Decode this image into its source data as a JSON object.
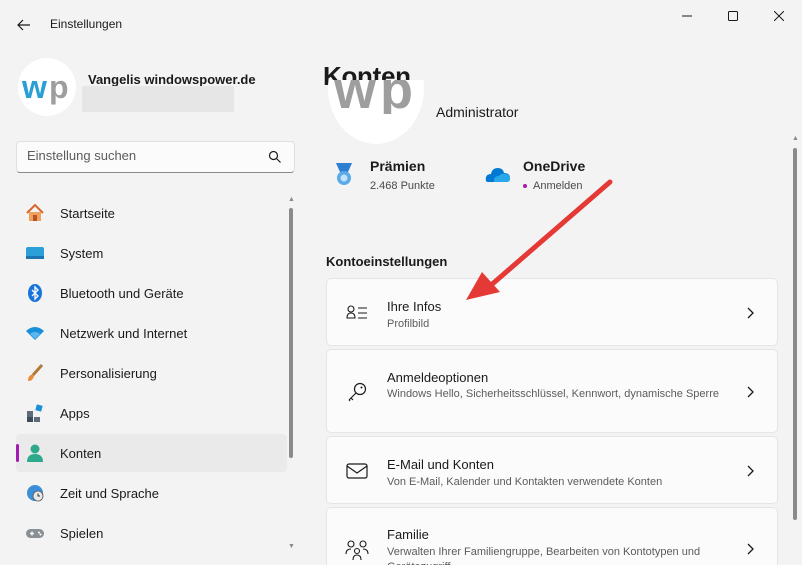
{
  "window": {
    "title": "Einstellungen"
  },
  "profile": {
    "avatar_text": "wp",
    "name": "Vangelis windowspower.de"
  },
  "search": {
    "placeholder": "Einstellung suchen"
  },
  "sidebar": {
    "items": [
      {
        "label": "Startseite",
        "icon": "home-icon"
      },
      {
        "label": "System",
        "icon": "system-icon"
      },
      {
        "label": "Bluetooth und Geräte",
        "icon": "bluetooth-icon"
      },
      {
        "label": "Netzwerk und Internet",
        "icon": "wifi-icon"
      },
      {
        "label": "Personalisierung",
        "icon": "brush-icon"
      },
      {
        "label": "Apps",
        "icon": "apps-icon"
      },
      {
        "label": "Konten",
        "icon": "account-icon",
        "active": true
      },
      {
        "label": "Zeit und Sprache",
        "icon": "globe-clock-icon"
      },
      {
        "label": "Spielen",
        "icon": "gamepad-icon"
      }
    ]
  },
  "main": {
    "title": "Konten",
    "role": "Administrator",
    "rewards": {
      "title": "Prämien",
      "subtitle": "2.468 Punkte"
    },
    "onedrive": {
      "title": "OneDrive",
      "subtitle": "Anmelden"
    },
    "section_heading": "Kontoeinstellungen",
    "cards": [
      {
        "title": "Ihre Infos",
        "subtitle": "Profilbild",
        "icon": "person-info-icon"
      },
      {
        "title": "Anmeldeoptionen",
        "subtitle": "Windows Hello, Sicherheitsschlüssel, Kennwort, dynamische Sperre",
        "icon": "key-icon"
      },
      {
        "title": "E-Mail und Konten",
        "subtitle": "Von E-Mail, Kalender und Kontakten verwendete Konten",
        "icon": "mail-icon"
      },
      {
        "title": "Familie",
        "subtitle": "Verwalten Ihrer Familiengruppe, Bearbeiten von Kontotypen und Gerätezugriff",
        "icon": "family-icon"
      }
    ]
  },
  "colors": {
    "accent": "#a21caf",
    "annotation_arrow": "#e53935",
    "onedrive": "#0078d4"
  }
}
